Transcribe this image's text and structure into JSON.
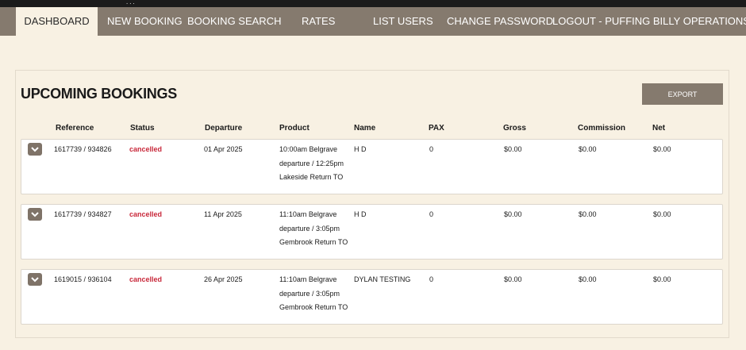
{
  "topbar": {
    "mark": "..."
  },
  "nav": {
    "items": [
      {
        "label": "DASHBOARD",
        "active": true
      },
      {
        "label": "NEW BOOKING"
      },
      {
        "label": "BOOKING SEARCH"
      },
      {
        "label": "RATES"
      },
      {
        "label": "LIST USERS"
      },
      {
        "label": "CHANGE PASSWORD"
      },
      {
        "label": "LOGOUT - PUFFING BILLY OPERATIONS"
      }
    ]
  },
  "bookings": {
    "title": "UPCOMING BOOKINGS",
    "export_label": "EXPORT",
    "columns": [
      "Reference",
      "Status",
      "Departure",
      "Product",
      "Name",
      "PAX",
      "Gross",
      "Commission",
      "Net"
    ],
    "rows": [
      {
        "reference": "1617739 / 934826",
        "status": "cancelled",
        "departure": "01 Apr 2025",
        "product": "10:00am Belgrave departure / 12:25pm Lakeside Return TO",
        "name": "H D",
        "pax": "0",
        "gross": "$0.00",
        "commission": "$0.00",
        "net": "$0.00"
      },
      {
        "reference": "1617739 / 934827",
        "status": "cancelled",
        "departure": "11 Apr 2025",
        "product": "11:10am Belgrave departure / 3:05pm Gembrook Return TO",
        "name": "H D",
        "pax": "0",
        "gross": "$0.00",
        "commission": "$0.00",
        "net": "$0.00"
      },
      {
        "reference": "1619015 / 936104",
        "status": "cancelled",
        "departure": "26 Apr 2025",
        "product": "11:10am Belgrave departure / 3:05pm Gembrook Return TO",
        "name": "DYLAN TESTING",
        "pax": "0",
        "gross": "$0.00",
        "commission": "$0.00",
        "net": "$0.00"
      }
    ]
  },
  "icons": {
    "row_toggle": "chevron-down-icon"
  },
  "colors": {
    "nav_bg": "#857a6e",
    "page_bg": "#f8f1e3",
    "status_cancelled": "#c8283a",
    "button_bg": "#857a6e"
  }
}
